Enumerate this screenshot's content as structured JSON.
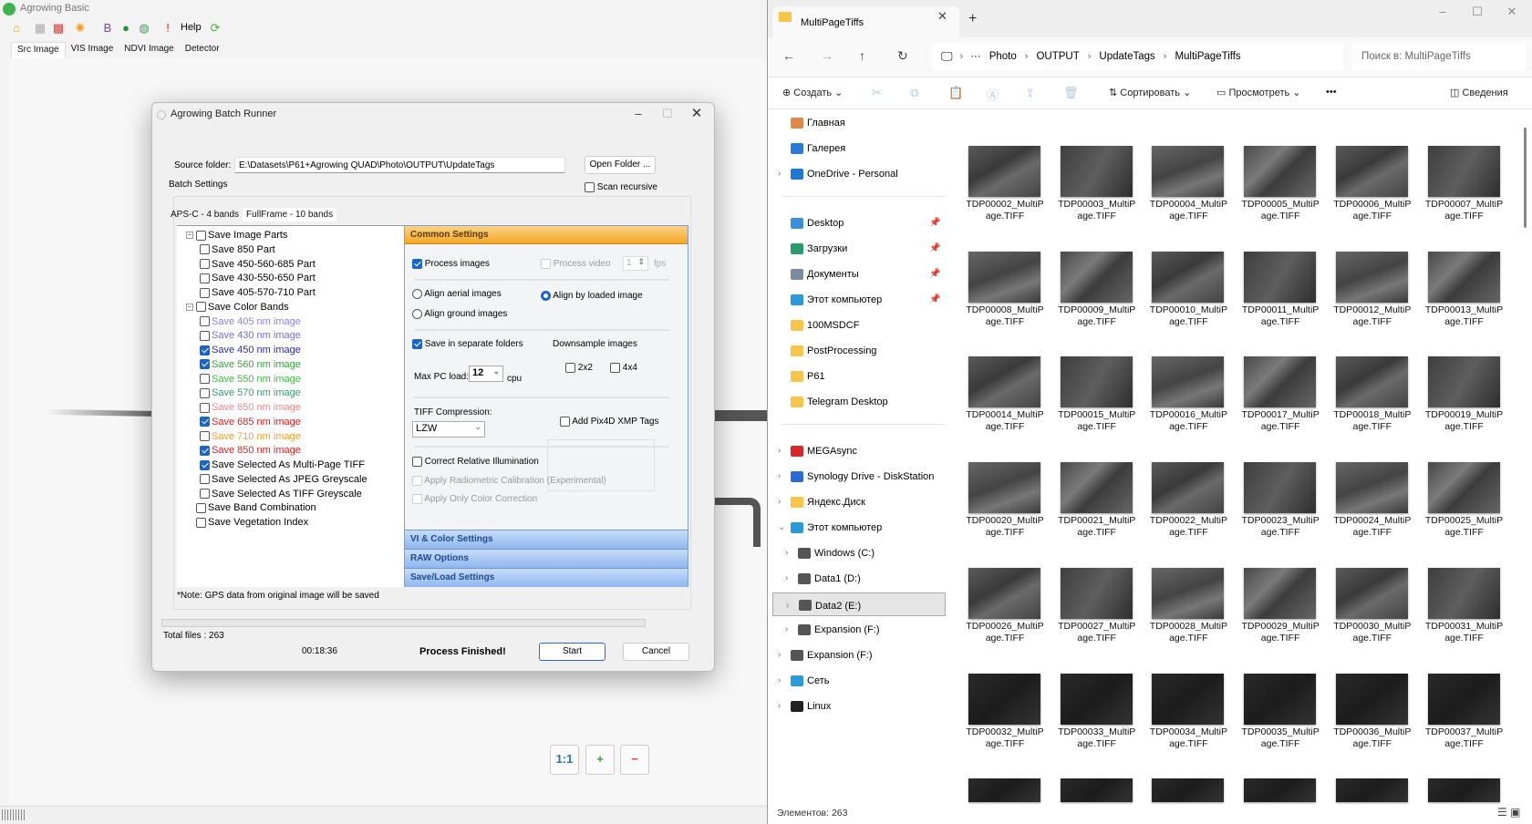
{
  "app": {
    "title": "Agrowing Basic",
    "toolbar": {
      "help_label": "Help"
    },
    "tabs": [
      "Src Image",
      "VIS Image",
      "NDVI Image",
      "Detector"
    ],
    "active_tab": "Src Image",
    "zoom_buttons": {
      "one_to_one": "1:1",
      "zoom_in": "+",
      "zoom_out": "−"
    }
  },
  "dialog": {
    "title": "Agrowing Batch Runner",
    "source_folder_label": "Source folder:",
    "source_folder_value": "E:\\Datasets\\P61+Agrowing QUAD\\Photo\\OUTPUT\\UpdateTags",
    "open_folder_label": "Open Folder ...",
    "scan_recursive_label": "Scan recursive",
    "scan_recursive": false,
    "batch_settings_label": "Batch Settings",
    "tabs": [
      "APS-C - 4 bands",
      "FullFrame - 10 bands"
    ],
    "active_tab": "FullFrame - 10 bands",
    "tree": [
      {
        "label": "Save Image Parts",
        "level": 0,
        "checked": false,
        "expander": "−",
        "color": "#000000"
      },
      {
        "label": "Save 850 Part",
        "level": 1,
        "checked": false,
        "color": "#000000"
      },
      {
        "label": "Save 450-560-685 Part",
        "level": 1,
        "checked": false,
        "color": "#000000"
      },
      {
        "label": "Save 430-550-650 Part",
        "level": 1,
        "checked": false,
        "color": "#000000"
      },
      {
        "label": "Save 405-570-710 Part",
        "level": 1,
        "checked": false,
        "color": "#000000"
      },
      {
        "label": "Save Color Bands",
        "level": 0,
        "checked": false,
        "expander": "−",
        "color": "#000000"
      },
      {
        "label": "Save 405 nm image",
        "level": 1,
        "checked": false,
        "color": "#8a84e0"
      },
      {
        "label": "Save 430 nm image",
        "level": 1,
        "checked": false,
        "color": "#7070d8"
      },
      {
        "label": "Save 450 nm image",
        "level": 1,
        "checked": true,
        "color": "#2a2ab8"
      },
      {
        "label": "Save 560 nm image",
        "level": 1,
        "checked": true,
        "color": "#3aa040"
      },
      {
        "label": "Save 550 nm image",
        "level": 1,
        "checked": false,
        "color": "#3cc040"
      },
      {
        "label": "Save 570 nm image",
        "level": 1,
        "checked": false,
        "color": "#3a9a70"
      },
      {
        "label": "Save 650 nm image",
        "level": 1,
        "checked": false,
        "color": "#f08a8a"
      },
      {
        "label": "Save 685 nm image",
        "level": 1,
        "checked": true,
        "color": "#e02020"
      },
      {
        "label": "Save 710 nm image",
        "level": 1,
        "checked": false,
        "color": "#f0a030"
      },
      {
        "label": "Save 850 nm image",
        "level": 1,
        "checked": true,
        "color": "#e02020"
      },
      {
        "label": "Save Selected As Multi-Page TIFF",
        "level": 1,
        "checked": true,
        "color": "#000000"
      },
      {
        "label": "Save Selected As JPEG Greyscale",
        "level": 1,
        "checked": false,
        "color": "#000000"
      },
      {
        "label": "Save Selected As TIFF Greyscale",
        "level": 1,
        "checked": false,
        "color": "#000000"
      },
      {
        "label": "Save Band Combination",
        "level": 0,
        "checked": false,
        "color": "#000000"
      },
      {
        "label": "Save Vegetation Index",
        "level": 0,
        "checked": false,
        "color": "#000000"
      }
    ],
    "common": {
      "header": "Common Settings",
      "process_images_label": "Process images",
      "process_images": true,
      "process_video_label": "Process video",
      "process_video": false,
      "fps_value": "1",
      "fps_label": "fps",
      "align_aerial_label": "Align aerial images",
      "align_ground_label": "Align ground images",
      "align_loaded_label": "Align by loaded image",
      "align_selected": "Align by loaded image",
      "separate_folders_label": "Save in separate folders",
      "separate_folders": true,
      "downsample_label": "Downsample images",
      "ds_2x2_label": "2x2",
      "ds_2x2": false,
      "ds_4x4_label": "4x4",
      "ds_4x4": false,
      "max_pc_load_label": "Max PC load:",
      "max_pc_load_value": "12",
      "cpu_label": "cpu",
      "tiff_compression_label": "TIFF Compression:",
      "tiff_compression_value": "LZW",
      "pix4d_label": "Add Pix4D XMP Tags",
      "pix4d": false,
      "correct_illum_label": "Correct Relative Illumination",
      "correct_illum": false,
      "radiometric_label": "Apply Radiometric Calibration (Experimental)",
      "color_correction_label": "Apply Only Color Correction"
    },
    "accordion": [
      "VI & Color Settings",
      "RAW Options",
      "Save/Load Settings"
    ],
    "note": "*Note: GPS data from original image will be saved",
    "progress": 0,
    "total_files": "Total files : 263",
    "elapsed": "00:18:36",
    "status": "Process Finished!",
    "start_label": "Start",
    "cancel_label": "Cancel"
  },
  "explorer": {
    "tab_title": "MultiPageTiffs",
    "new_tab": "+",
    "breadcrumbs": [
      "Photo",
      "OUTPUT",
      "UpdateTags",
      "MultiPageTiffs"
    ],
    "overflow": "···",
    "search_placeholder": "Поиск в: MultiPageTiffs",
    "commands": {
      "create": "Создать",
      "sort": "Сортировать",
      "view": "Просмотреть",
      "more": "•••",
      "details": "Сведения"
    },
    "sidebar": [
      {
        "label": "Главная",
        "icon": "home-icon",
        "color": "#e08a4a"
      },
      {
        "label": "Галерея",
        "icon": "gallery-icon",
        "color": "#2b7bd6"
      },
      {
        "label": "OneDrive - Personal",
        "icon": "cloud-icon",
        "color": "#1e78d4",
        "chevron": "›"
      },
      {
        "divider": true
      },
      {
        "label": "Desktop",
        "icon": "desktop-icon",
        "color": "#3a8fd8",
        "pinned": true
      },
      {
        "label": "Загрузки",
        "icon": "download-icon",
        "color": "#2a9a6a",
        "pinned": true
      },
      {
        "label": "Документы",
        "icon": "documents-icon",
        "color": "#7a8aa0",
        "pinned": true
      },
      {
        "label": "Этот компьютер",
        "icon": "computer-icon",
        "color": "#2a9ad8",
        "pinned": true
      },
      {
        "label": "100MSDCF",
        "icon": "folder-icon",
        "color": "#f6c54a"
      },
      {
        "label": "PostProcessing",
        "icon": "folder-icon",
        "color": "#f6c54a"
      },
      {
        "label": "P61",
        "icon": "folder-icon",
        "color": "#f6c54a"
      },
      {
        "label": "Telegram Desktop",
        "icon": "folder-icon",
        "color": "#f6c54a"
      },
      {
        "divider": true
      },
      {
        "label": "MEGAsync",
        "icon": "mega-icon",
        "color": "#d9272e",
        "chevron": "›"
      },
      {
        "label": "Synology Drive - DiskStation",
        "icon": "synology-icon",
        "color": "#2a6ad8",
        "chevron": "›"
      },
      {
        "label": "Яндекс.Диск",
        "icon": "yandex-disk-icon",
        "color": "#f6c54a",
        "chevron": "›"
      },
      {
        "label": "Этот компьютер",
        "icon": "computer-icon",
        "color": "#2a9ad8",
        "chevron": "⌄"
      },
      {
        "label": "Windows (C:)",
        "icon": "drive-icon",
        "color": "#555555",
        "chevron": "›",
        "indent": true
      },
      {
        "label": "Data1 (D:)",
        "icon": "drive-icon",
        "color": "#555555",
        "chevron": "›",
        "indent": true
      },
      {
        "label": "Data2 (E:)",
        "icon": "drive-icon",
        "color": "#555555",
        "chevron": "›",
        "indent": true,
        "selected": true
      },
      {
        "label": "Expansion (F:)",
        "icon": "drive-icon",
        "color": "#555555",
        "chevron": "›",
        "indent": true
      },
      {
        "label": "Expansion (F:)",
        "icon": "drive-icon",
        "color": "#555555",
        "chevron": "›"
      },
      {
        "label": "Сеть",
        "icon": "network-icon",
        "color": "#2a9ad8",
        "chevron": "›"
      },
      {
        "label": "Linux",
        "icon": "linux-icon",
        "color": "#222222",
        "chevron": "›"
      }
    ],
    "files": [
      "TDP00002_MultiPage.TIFF",
      "TDP00003_MultiPage.TIFF",
      "TDP00004_MultiPage.TIFF",
      "TDP00005_MultiPage.TIFF",
      "TDP00006_MultiPage.TIFF",
      "TDP00007_MultiPage.TIFF",
      "TDP00008_MultiPage.TIFF",
      "TDP00009_MultiPage.TIFF",
      "TDP00010_MultiPage.TIFF",
      "TDP00011_MultiPage.TIFF",
      "TDP00012_MultiPage.TIFF",
      "TDP00013_MultiPage.TIFF",
      "TDP00014_MultiPage.TIFF",
      "TDP00015_MultiPage.TIFF",
      "TDP00016_MultiPage.TIFF",
      "TDP00017_MultiPage.TIFF",
      "TDP00018_MultiPage.TIFF",
      "TDP00019_MultiPage.TIFF",
      "TDP00020_MultiPage.TIFF",
      "TDP00021_MultiPage.TIFF",
      "TDP00022_MultiPage.TIFF",
      "TDP00023_MultiPage.TIFF",
      "TDP00024_MultiPage.TIFF",
      "TDP00025_MultiPage.TIFF",
      "TDP00026_MultiPage.TIFF",
      "TDP00027_MultiPage.TIFF",
      "TDP00028_MultiPage.TIFF",
      "TDP00029_MultiPage.TIFF",
      "TDP00030_MultiPage.TIFF",
      "TDP00031_MultiPage.TIFF",
      "TDP00032_MultiPage.TIFF",
      "TDP00033_MultiPage.TIFF",
      "TDP00034_MultiPage.TIFF",
      "TDP00035_MultiPage.TIFF",
      "TDP00036_MultiPage.TIFF",
      "TDP00037_MultiPage.TIFF"
    ],
    "status": "Элементов: 263"
  }
}
